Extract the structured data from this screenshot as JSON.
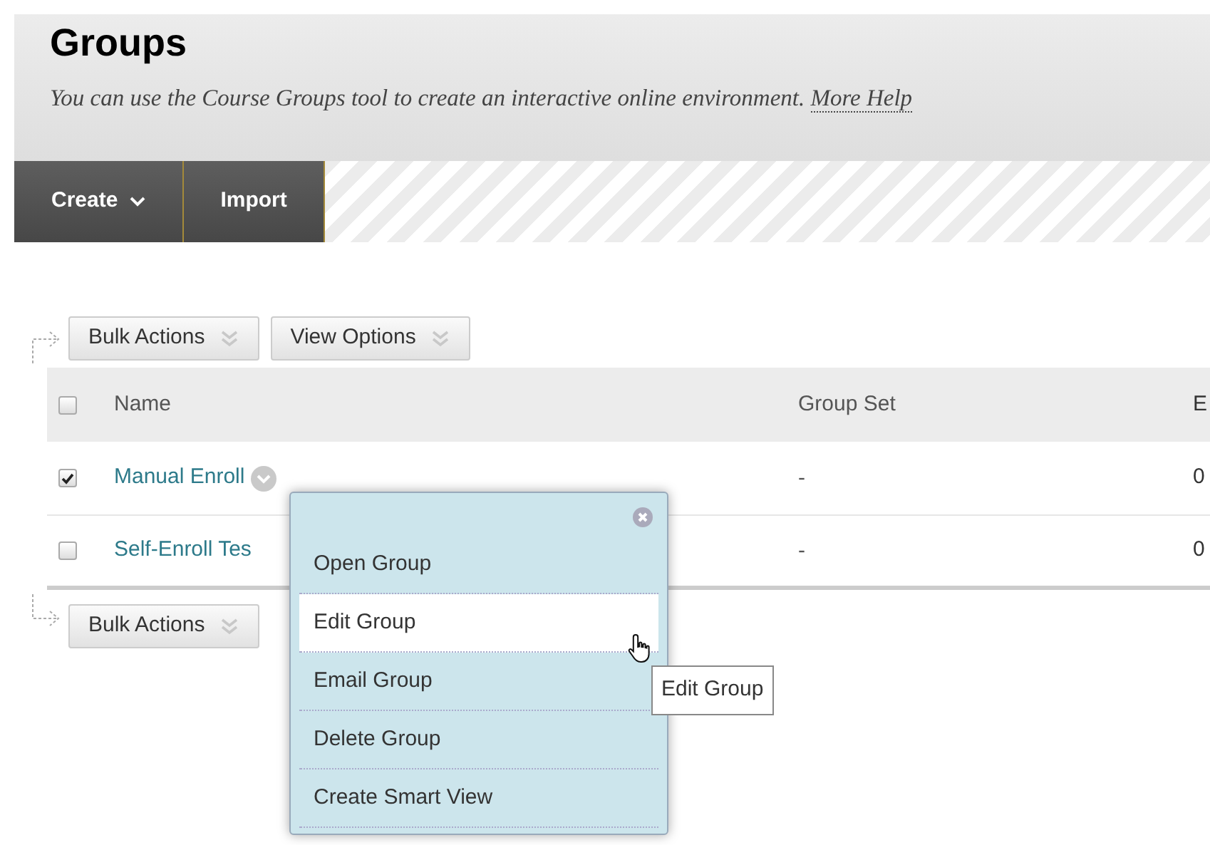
{
  "page": {
    "title": "Groups",
    "description": "You can use the Course Groups tool to create an interactive online environment.",
    "help_link": "More Help"
  },
  "toolbar": [
    {
      "label": "Create",
      "dropdown": true
    },
    {
      "label": "Import",
      "dropdown": false
    }
  ],
  "top_actions": [
    "Bulk Actions",
    "View Options"
  ],
  "table": {
    "columns": [
      "Name",
      "Group Set",
      "E"
    ],
    "header_checked": false,
    "rows": [
      {
        "checked": true,
        "name": "Manual Enroll",
        "menu_button": true,
        "group_set": "-",
        "column_3": "0"
      },
      {
        "checked": false,
        "name": "Self-Enroll Tes",
        "menu_button": false,
        "group_set": "-",
        "column_3": "0"
      }
    ]
  },
  "bottom_actions": [
    "Bulk Actions"
  ],
  "context_menu": {
    "items": [
      {
        "label": "Open Group",
        "selected": false
      },
      {
        "label": "Edit Group",
        "selected": true
      },
      {
        "label": "Email Group",
        "selected": false
      },
      {
        "label": "Delete Group",
        "selected": false
      },
      {
        "label": "Create Smart View",
        "selected": false
      }
    ]
  },
  "tooltip": "Edit Group"
}
